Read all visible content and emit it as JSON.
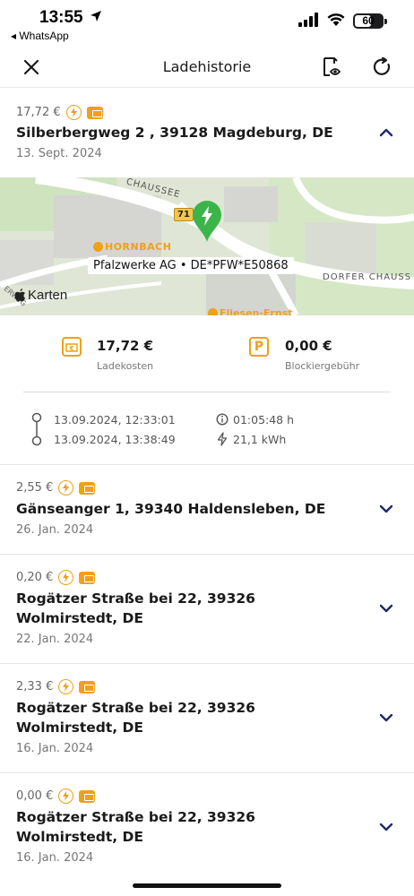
{
  "status_bar": {
    "time": "13:55",
    "back_app": "◂ WhatsApp",
    "battery": "60",
    "battery_level": 0.6
  },
  "header": {
    "title": "Ladehistorie"
  },
  "icons": {
    "close": "close-icon",
    "export": "document-view-icon",
    "refresh": "refresh-icon"
  },
  "accent_color": "#f0a019",
  "chevron_color": "#1d2a6b",
  "sessions": [
    {
      "price": "17,72 €",
      "address": "Silberbergweg 2  , 39128 Magdeburg, DE",
      "date": "13. Sept. 2024",
      "expanded": true
    },
    {
      "price": "2,55 €",
      "address": "Gänseanger 1, 39340 Haldensleben, DE",
      "date": "26. Jan. 2024",
      "expanded": false
    },
    {
      "price": "0,20 €",
      "address_line1": "Rogätzer Straße bei 22, 39326",
      "address_line2": "Wolmirstedt, DE",
      "date": "22. Jan. 2024",
      "expanded": false
    },
    {
      "price": "2,33 €",
      "address_line1": "Rogätzer Straße bei 22, 39326",
      "address_line2": "Wolmirstedt, DE",
      "date": "16. Jan. 2024",
      "expanded": false
    },
    {
      "price": "0,00 €",
      "address_line1": "Rogätzer Straße bei 22, 39326",
      "address_line2": "Wolmirstedt, DE",
      "date": "16. Jan. 2024",
      "expanded": false
    }
  ],
  "map": {
    "street_1": "CHAUSSEE",
    "street_2": "DORFER CHAUSS",
    "street_3": "ERWEG",
    "road_number": "71",
    "poi": "HORNBACH",
    "poi_2": "Fliesen-Ernst",
    "operator_label": "Pfalzwerke AG • DE*PFW*E50868",
    "attribution": "Karten"
  },
  "details": {
    "charging_cost": "17,72 €",
    "charging_cost_label": "Ladekosten",
    "blocking_fee": "0,00 €",
    "blocking_fee_label": "Blockiergebühr",
    "start": "13.09.2024, 12:33:01",
    "end": "13.09.2024, 13:38:49",
    "duration": "01:05:48 h",
    "energy": "21,1 kWh"
  }
}
